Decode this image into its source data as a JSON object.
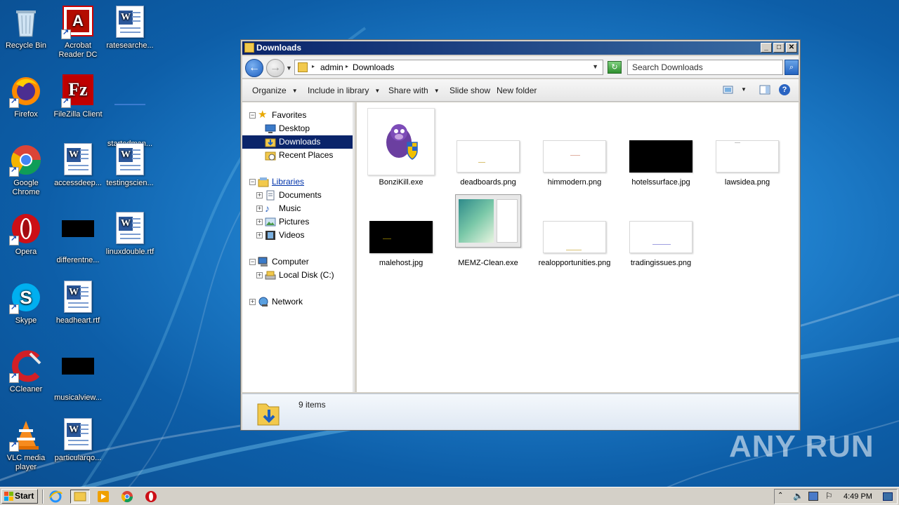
{
  "desktop": {
    "icons": [
      {
        "label": "Recycle Bin"
      },
      {
        "label": "Acrobat Reader DC"
      },
      {
        "label": "ratesearche..."
      },
      {
        "label": "Firefox"
      },
      {
        "label": "FileZilla Client"
      },
      {
        "label": "startedman..."
      },
      {
        "label": "Google Chrome"
      },
      {
        "label": "accessdeep..."
      },
      {
        "label": "testingscien..."
      },
      {
        "label": "Opera"
      },
      {
        "label": "differentne..."
      },
      {
        "label": "linuxdouble.rtf"
      },
      {
        "label": "Skype"
      },
      {
        "label": "headheart.rtf"
      },
      {
        "label": "CCleaner"
      },
      {
        "label": "musicalview..."
      },
      {
        "label": "VLC media player"
      },
      {
        "label": "particularqo..."
      }
    ]
  },
  "window": {
    "title": "Downloads",
    "address": {
      "crumbs": [
        "admin",
        "Downloads"
      ]
    },
    "search": {
      "placeholder": "Search Downloads"
    },
    "toolbar": {
      "organize": "Organize",
      "include_in_library": "Include in library",
      "share_with": "Share with",
      "slide_show": "Slide show",
      "new_folder": "New folder"
    },
    "nav": {
      "favorites": "Favorites",
      "desktop": "Desktop",
      "downloads": "Downloads",
      "recent_places": "Recent Places",
      "libraries": "Libraries",
      "documents": "Documents",
      "music": "Music",
      "pictures": "Pictures",
      "videos": "Videos",
      "computer": "Computer",
      "local_disk": "Local Disk (C:)",
      "network": "Network"
    },
    "files": [
      {
        "name": "BonziKill.exe"
      },
      {
        "name": "deadboards.png"
      },
      {
        "name": "himmodern.png"
      },
      {
        "name": "hotelssurface.jpg"
      },
      {
        "name": "lawsidea.png"
      },
      {
        "name": "malehost.jpg"
      },
      {
        "name": "MEMZ-Clean.exe"
      },
      {
        "name": "realopportunities.png"
      },
      {
        "name": "tradingissues.png"
      }
    ],
    "status": {
      "item_count": "9 items"
    }
  },
  "taskbar": {
    "start_label": "Start",
    "clock": "4:49 PM"
  },
  "watermark": "ANY RUN"
}
